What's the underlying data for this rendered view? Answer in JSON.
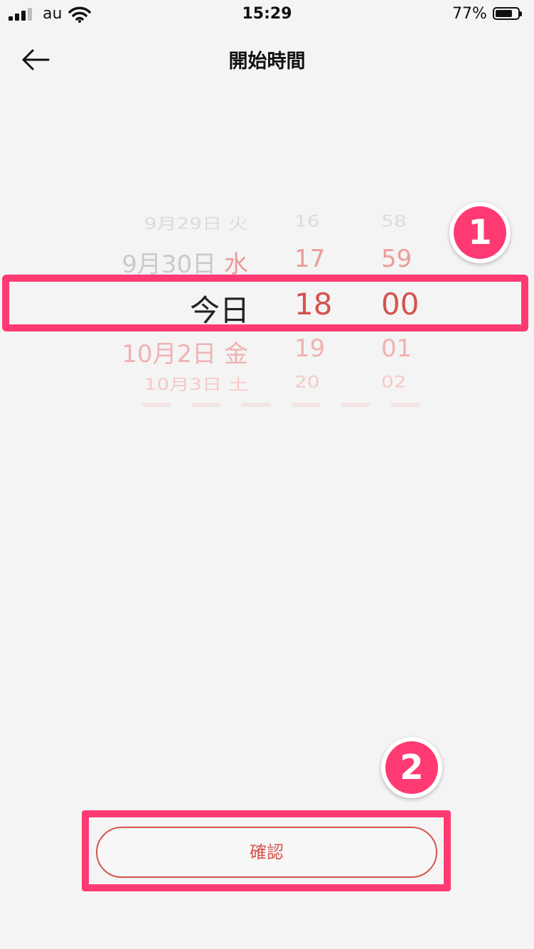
{
  "status_bar": {
    "carrier": "au",
    "time": "15:29",
    "battery": "77%",
    "battery_level": 0.77
  },
  "header": {
    "title": "開始時間"
  },
  "picker": {
    "rows": [
      {
        "date": "9月29日",
        "weekday": "火",
        "hour": "16",
        "minute": "58"
      },
      {
        "date": "9月30日",
        "weekday": "水",
        "hour": "17",
        "minute": "59"
      },
      {
        "date": "今日",
        "weekday": "",
        "hour": "18",
        "minute": "00"
      },
      {
        "date": "10月2日",
        "weekday": "金",
        "hour": "19",
        "minute": "01"
      },
      {
        "date": "10月3日",
        "weekday": "土",
        "hour": "20",
        "minute": "02"
      }
    ]
  },
  "annotations": {
    "marker1": "1",
    "marker2": "2"
  },
  "footer": {
    "confirm_label": "確認"
  },
  "colors": {
    "accent": "#d4544c",
    "highlight": "#ff3a73",
    "background": "#f4f4f4"
  }
}
